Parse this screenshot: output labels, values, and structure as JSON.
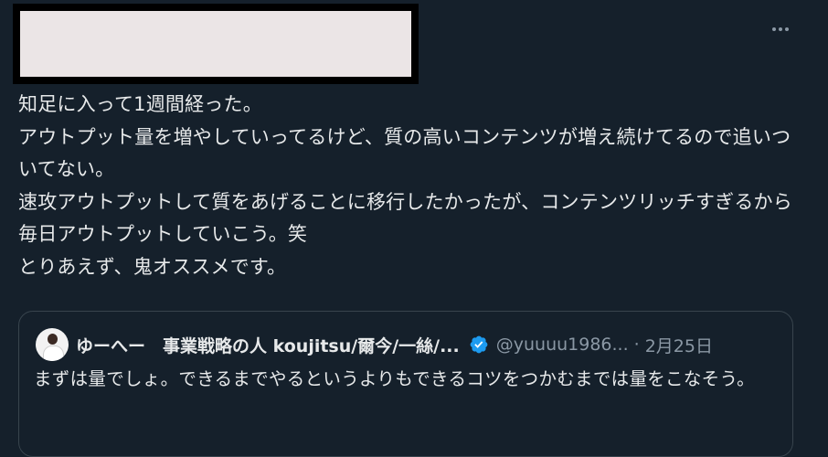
{
  "tweet": {
    "text": "知足に入って1週間経った。\nアウトプット量を増やしていってるけど、質の高いコンテンツが増え続けてるので追いついてない。\n速攻アウトプットして質をあげることに移行したかったが、コンテンツリッチすぎるから毎日アウトプットしていこう。笑\nとりあえず、鬼オススメです。"
  },
  "quote": {
    "display_name": "ゆーへー　事業戦略の人 koujitsu/爾今/一絲/...",
    "handle": "@yuuuu1986...",
    "separator": "·",
    "date": "2月25日",
    "text": "まずは量でしょ。できるまでやるというよりもできるコツをつかむまでは量をこなそう。"
  },
  "icons": {
    "more": "more-horizontal-icon",
    "verified": "verified-badge-icon"
  },
  "colors": {
    "background": "#15202b",
    "text": "#e7e9ea",
    "secondary": "#8b98a5",
    "border": "#38444d",
    "verified": "#1d9bf0"
  }
}
